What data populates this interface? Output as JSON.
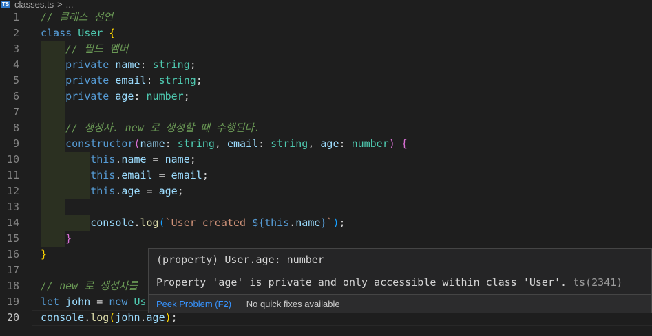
{
  "breadcrumb": {
    "file_badge": "TS",
    "file_name": "classes.ts",
    "separator": ">",
    "more": "..."
  },
  "editor": {
    "line_numbers": [
      "1",
      "2",
      "3",
      "4",
      "5",
      "6",
      "7",
      "8",
      "9",
      "10",
      "11",
      "12",
      "13",
      "14",
      "15",
      "16",
      "17",
      "18",
      "19",
      "20"
    ],
    "current_line": 20,
    "lines": [
      [
        {
          "t": "// 클래스 선언",
          "c": "cmt"
        }
      ],
      [
        {
          "t": "class",
          "c": "kw"
        },
        {
          "t": " "
        },
        {
          "t": "User",
          "c": "cls"
        },
        {
          "t": " "
        },
        {
          "t": "{",
          "c": "br1"
        }
      ],
      [
        {
          "t": "    "
        },
        {
          "t": "// 필드 멤버",
          "c": "cmt"
        }
      ],
      [
        {
          "t": "    "
        },
        {
          "t": "private",
          "c": "kw"
        },
        {
          "t": " "
        },
        {
          "t": "name",
          "c": "prop"
        },
        {
          "t": ": "
        },
        {
          "t": "string",
          "c": "typ"
        },
        {
          "t": ";"
        }
      ],
      [
        {
          "t": "    "
        },
        {
          "t": "private",
          "c": "kw"
        },
        {
          "t": " "
        },
        {
          "t": "email",
          "c": "prop"
        },
        {
          "t": ": "
        },
        {
          "t": "string",
          "c": "typ"
        },
        {
          "t": ";"
        }
      ],
      [
        {
          "t": "    "
        },
        {
          "t": "private",
          "c": "kw"
        },
        {
          "t": " "
        },
        {
          "t": "age",
          "c": "prop"
        },
        {
          "t": ": "
        },
        {
          "t": "number",
          "c": "typ"
        },
        {
          "t": ";"
        }
      ],
      [],
      [
        {
          "t": "    "
        },
        {
          "t": "// 생성자. new 로 생성할 때 수행된다.",
          "c": "cmt"
        }
      ],
      [
        {
          "t": "    "
        },
        {
          "t": "constructor",
          "c": "kw"
        },
        {
          "t": "(",
          "c": "br2"
        },
        {
          "t": "name",
          "c": "prop"
        },
        {
          "t": ": "
        },
        {
          "t": "string",
          "c": "typ"
        },
        {
          "t": ", "
        },
        {
          "t": "email",
          "c": "prop"
        },
        {
          "t": ": "
        },
        {
          "t": "string",
          "c": "typ"
        },
        {
          "t": ", "
        },
        {
          "t": "age",
          "c": "prop"
        },
        {
          "t": ": "
        },
        {
          "t": "number",
          "c": "typ"
        },
        {
          "t": ")",
          "c": "br2"
        },
        {
          "t": " "
        },
        {
          "t": "{",
          "c": "br2"
        }
      ],
      [
        {
          "t": "        "
        },
        {
          "t": "this",
          "c": "kw"
        },
        {
          "t": "."
        },
        {
          "t": "name",
          "c": "prop"
        },
        {
          "t": " = "
        },
        {
          "t": "name",
          "c": "prop"
        },
        {
          "t": ";"
        }
      ],
      [
        {
          "t": "        "
        },
        {
          "t": "this",
          "c": "kw"
        },
        {
          "t": "."
        },
        {
          "t": "email",
          "c": "prop"
        },
        {
          "t": " = "
        },
        {
          "t": "email",
          "c": "prop"
        },
        {
          "t": ";"
        }
      ],
      [
        {
          "t": "        "
        },
        {
          "t": "this",
          "c": "kw"
        },
        {
          "t": "."
        },
        {
          "t": "age",
          "c": "prop"
        },
        {
          "t": " = "
        },
        {
          "t": "age",
          "c": "prop"
        },
        {
          "t": ";"
        }
      ],
      [],
      [
        {
          "t": "        "
        },
        {
          "t": "console",
          "c": "prop"
        },
        {
          "t": "."
        },
        {
          "t": "log",
          "c": "fn"
        },
        {
          "t": "(",
          "c": "br3"
        },
        {
          "t": "`User created ",
          "c": "str"
        },
        {
          "t": "${",
          "c": "kw"
        },
        {
          "t": "this",
          "c": "kw"
        },
        {
          "t": "."
        },
        {
          "t": "name",
          "c": "prop"
        },
        {
          "t": "}",
          "c": "kw"
        },
        {
          "t": "`",
          "c": "str"
        },
        {
          "t": ")",
          "c": "br3"
        },
        {
          "t": ";"
        }
      ],
      [
        {
          "t": "    "
        },
        {
          "t": "}",
          "c": "br2"
        }
      ],
      [
        {
          "t": "}",
          "c": "br1"
        }
      ],
      [],
      [
        {
          "t": "// new 로 생성자를",
          "c": "cmt"
        }
      ],
      [
        {
          "t": "let",
          "c": "kw"
        },
        {
          "t": " "
        },
        {
          "t": "john",
          "c": "prop"
        },
        {
          "t": " = "
        },
        {
          "t": "new",
          "c": "kw"
        },
        {
          "t": " "
        },
        {
          "t": "Us",
          "c": "cls"
        }
      ],
      [
        {
          "t": "console",
          "c": "prop"
        },
        {
          "t": "."
        },
        {
          "t": "log",
          "c": "fn"
        },
        {
          "t": "(",
          "c": "br1"
        },
        {
          "t": "john",
          "c": "prop"
        },
        {
          "t": "."
        },
        {
          "t": "age",
          "c": "prop"
        },
        {
          "t": ")",
          "c": "br1"
        },
        {
          "t": ";"
        }
      ]
    ]
  },
  "hover": {
    "signature": "(property) User.age: number",
    "message": "Property 'age' is private and only accessible within class 'User'.",
    "code_ref": "ts(2341)",
    "peek_label": "Peek Problem (F2)",
    "no_fix_label": "No quick fixes available"
  }
}
